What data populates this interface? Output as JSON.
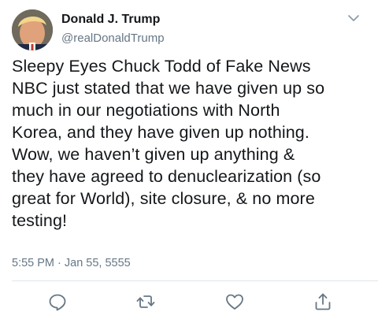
{
  "user": {
    "display_name": "Donald J. Trump",
    "handle": "@realDonaldTrump"
  },
  "tweet": {
    "text": "Sleepy Eyes Chuck Todd of Fake News\nNBC just stated that we have given up so\nmuch in our negotiations with North\nKorea, and they have given up nothing.\nWow, we haven’t given up anything &\nthey have agreed to denuclearization (so\ngreat for World), site closure, & no more\ntesting!",
    "timestamp": "5:55 PM · Jan 55, 5555"
  },
  "icons": {
    "menu": "chevron-down-icon",
    "reply": "reply-icon",
    "retweet": "retweet-icon",
    "like": "heart-icon",
    "share": "share-icon"
  },
  "colors": {
    "text_primary": "#14171a",
    "text_secondary": "#657786",
    "icon_gray": "#657786",
    "divider": "#e1e8ed"
  }
}
